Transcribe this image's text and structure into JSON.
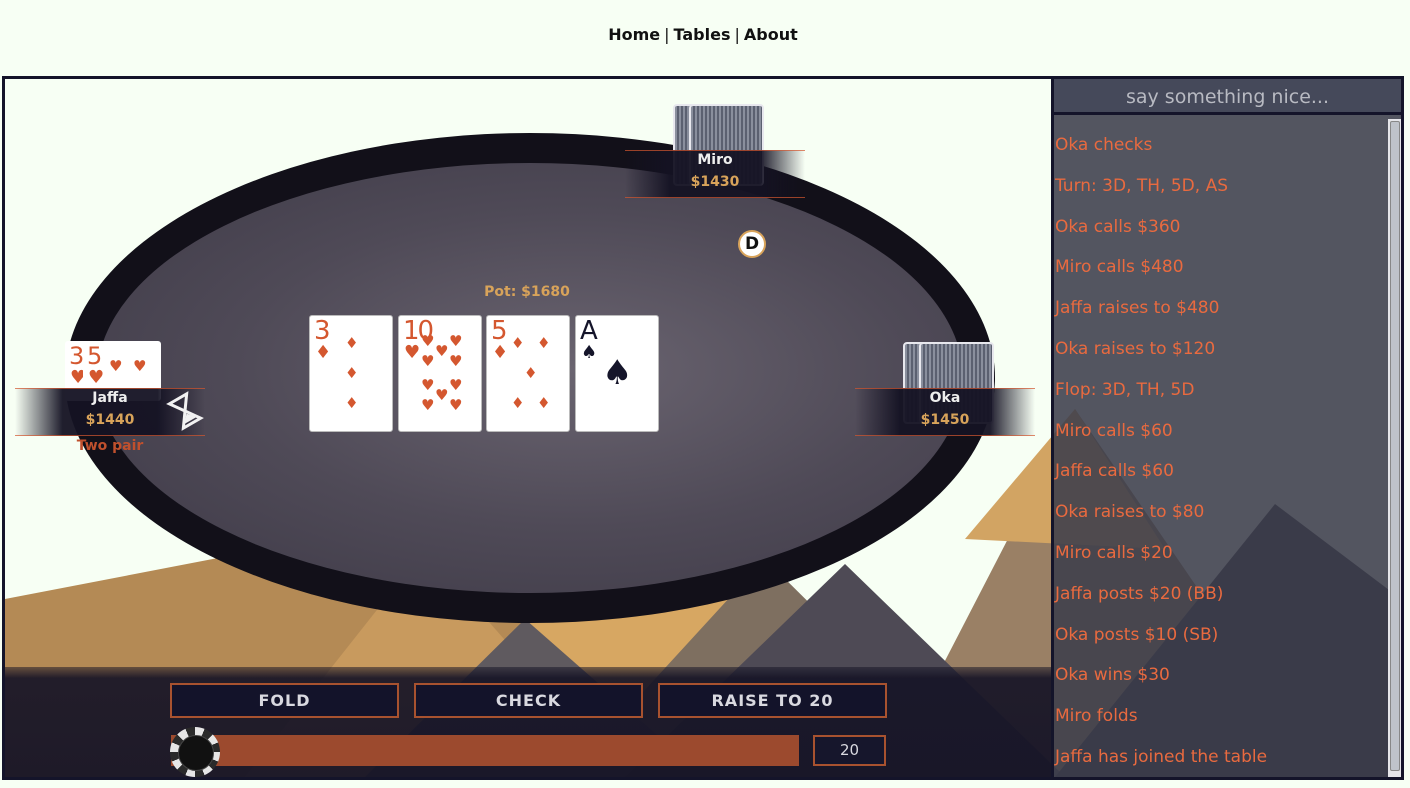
{
  "nav": {
    "home": "Home",
    "sep1": "|",
    "tables": "Tables",
    "sep2": "|",
    "about": "About"
  },
  "table": {
    "pot": "Pot: $1680",
    "dealer_button": "D",
    "board": [
      {
        "rank": "3",
        "suit": "♦",
        "color": "red"
      },
      {
        "rank": "10",
        "suit": "♥",
        "color": "red"
      },
      {
        "rank": "5",
        "suit": "♦",
        "color": "red"
      },
      {
        "rank": "A",
        "suit": "♠",
        "color": "black"
      }
    ]
  },
  "players": {
    "miro": {
      "name": "Miro",
      "stack": "$1430"
    },
    "jaffa": {
      "name": "Jaffa",
      "stack": "$1440",
      "hand": "Two pair",
      "cards": [
        {
          "rank": "3",
          "suit": "♥"
        },
        {
          "rank": "5",
          "suit": "♥"
        }
      ]
    },
    "oka": {
      "name": "Oka",
      "stack": "$1450"
    }
  },
  "actions": {
    "fold": "FOLD",
    "check": "CHECK",
    "raise": "RAISE TO 20",
    "amount": "20"
  },
  "chat": {
    "placeholder": "say something nice...",
    "lines": [
      "Oka checks",
      "Turn: 3D, TH, 5D, AS",
      "Oka calls $360",
      "Miro calls $480",
      "Jaffa raises to $480",
      "Oka raises to $120",
      "Flop: 3D, TH, 5D",
      "Miro calls $60",
      "Jaffa calls $60",
      "Oka raises to $80",
      "Miro calls $20",
      "Jaffa posts $20 (BB)",
      "Oka posts $10 (SB)",
      "Oka wins $30",
      "Miro folds",
      "Jaffa has joined the table"
    ]
  },
  "colors": {
    "accent": "#d4572f",
    "gold": "#d8a35a",
    "dark": "#14142a"
  }
}
